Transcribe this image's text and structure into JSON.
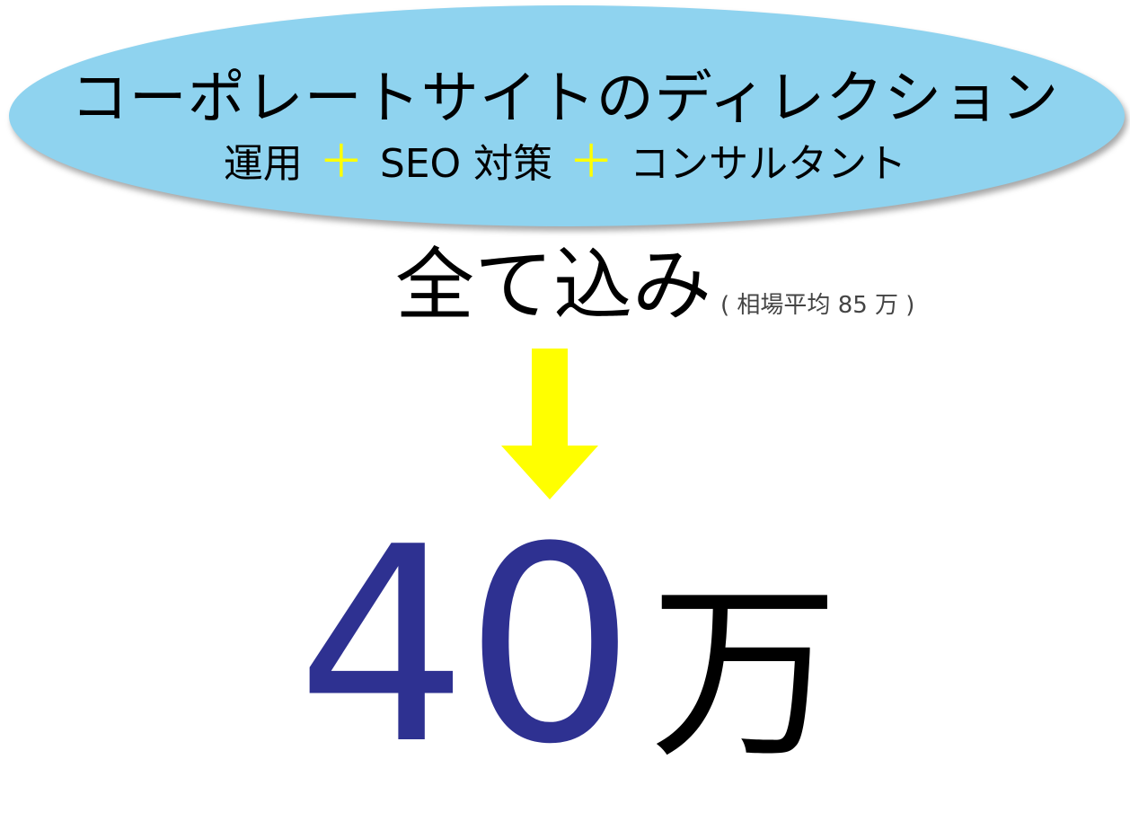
{
  "banner": {
    "title": "コーポレートサイトのディレクション",
    "services": [
      "運用",
      "SEO 対策",
      "コンサルタント"
    ],
    "separator": "＋"
  },
  "inclusion": {
    "label": "全て込み",
    "note": "( 相場平均 85 万 )"
  },
  "price": {
    "amount": "40",
    "unit": "万"
  },
  "colors": {
    "ellipse": "#8fd3ef",
    "plus": "#ffff00",
    "arrow": "#ffff00",
    "amount": "#2e3191"
  },
  "icons": {
    "arrow": "down-arrow-icon"
  }
}
